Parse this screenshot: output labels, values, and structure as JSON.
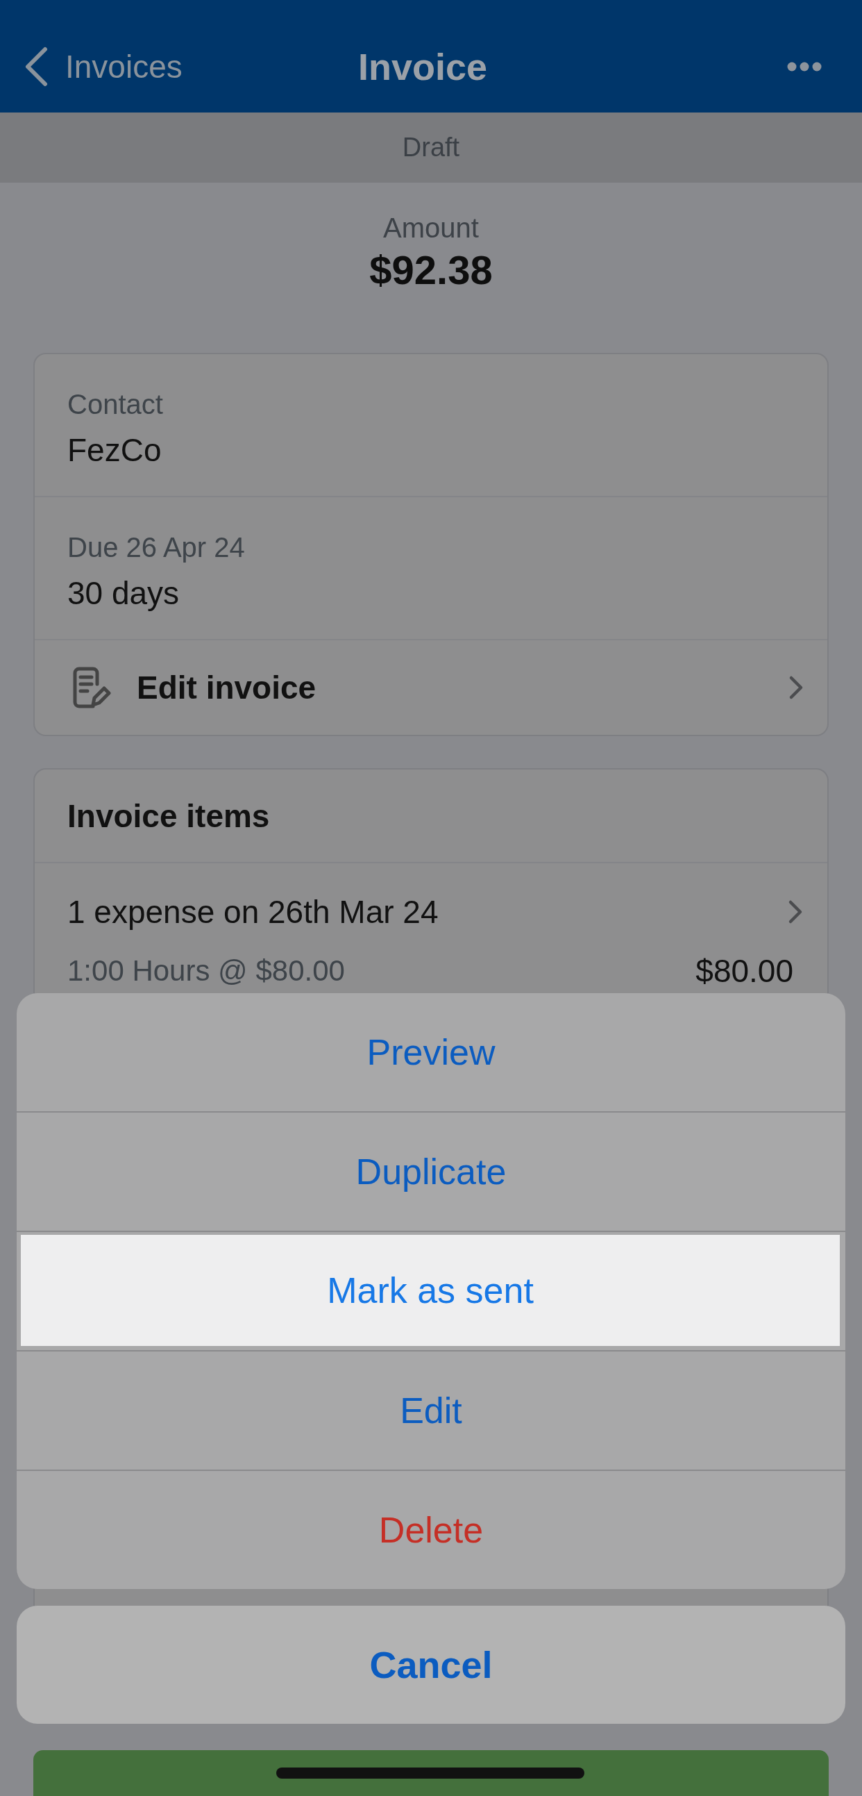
{
  "nav_bar": {
    "back_label": "Invoices",
    "title": "Invoice"
  },
  "status_banner": {
    "label": "Draft"
  },
  "amount": {
    "label": "Amount",
    "value": "$92.38"
  },
  "details_card": {
    "fields": [
      {
        "label": "Contact",
        "value": "FezCo"
      },
      {
        "label": "Due 26 Apr 24",
        "value": "30 days"
      }
    ],
    "edit_link": {
      "label": "Edit invoice"
    }
  },
  "invoice_items": {
    "title": "Invoice items",
    "items": [
      {
        "description": "1 expense on 26th Mar 24",
        "detail": "1:00 Hours @ $80.00",
        "amount": "$80.00"
      }
    ]
  },
  "action_sheet": {
    "actions": [
      {
        "label": "Preview",
        "kind": "default",
        "selected": false
      },
      {
        "label": "Duplicate",
        "kind": "default",
        "selected": false
      },
      {
        "label": "Mark as sent",
        "kind": "default",
        "selected": true
      },
      {
        "label": "Edit",
        "kind": "default",
        "selected": false
      },
      {
        "label": "Delete",
        "kind": "destructive",
        "selected": false
      }
    ],
    "cancel": {
      "label": "Cancel"
    }
  }
}
